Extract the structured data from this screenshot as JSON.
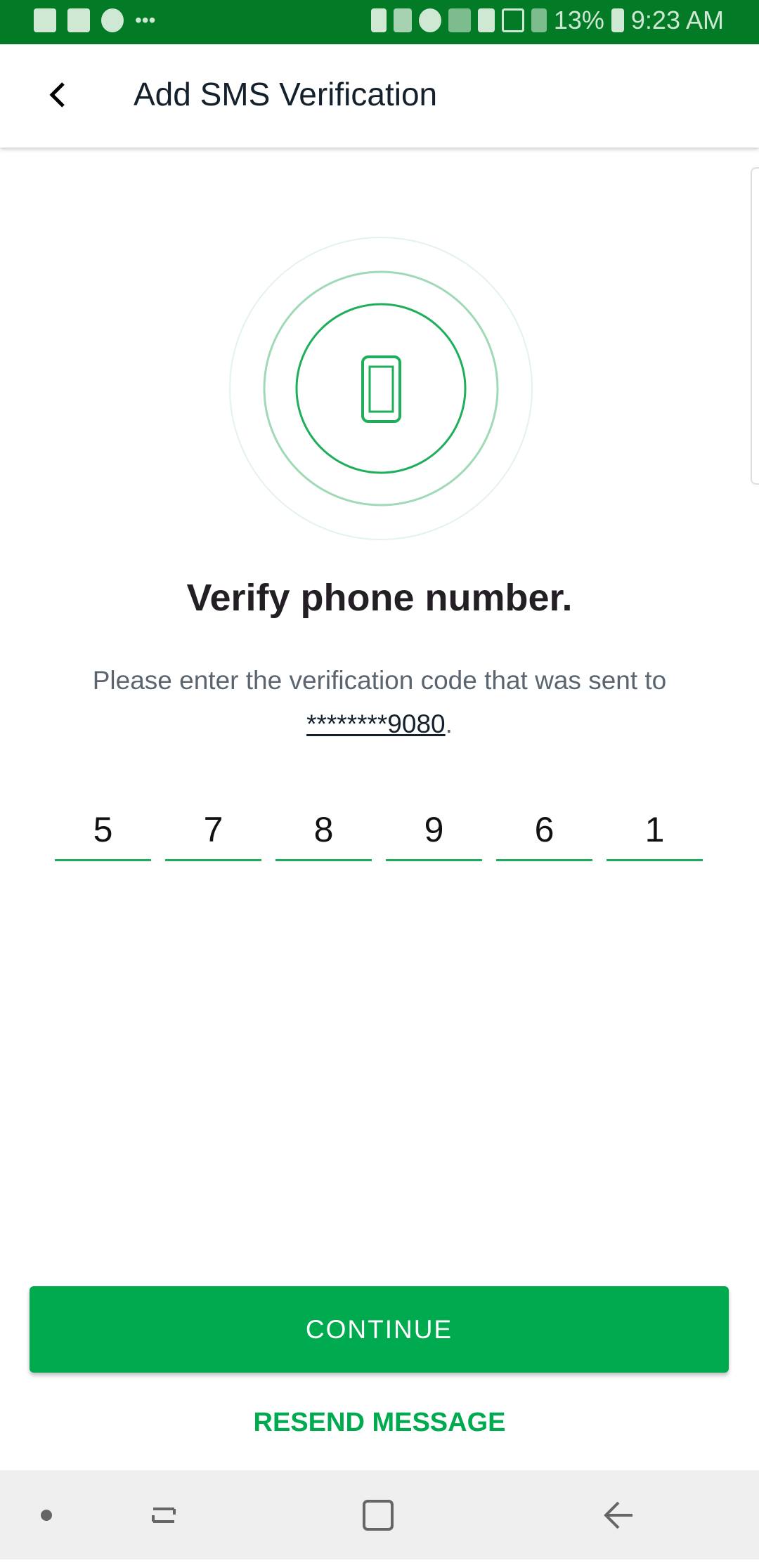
{
  "status_bar": {
    "battery": "13%",
    "time": "9:23 AM"
  },
  "header": {
    "title": "Add SMS Verification"
  },
  "main": {
    "heading": "Verify phone number.",
    "message_prefix": "Please enter the verification code that was sent to ",
    "phone_masked": "********9080",
    "message_suffix": ".",
    "code_digits": [
      "5",
      "7",
      "8",
      "9",
      "6",
      "1"
    ]
  },
  "actions": {
    "continue_label": "CONTINUE",
    "resend_label": "RESEND MESSAGE"
  },
  "colors": {
    "status_bar": "#037a25",
    "accent": "#00aa4f"
  }
}
